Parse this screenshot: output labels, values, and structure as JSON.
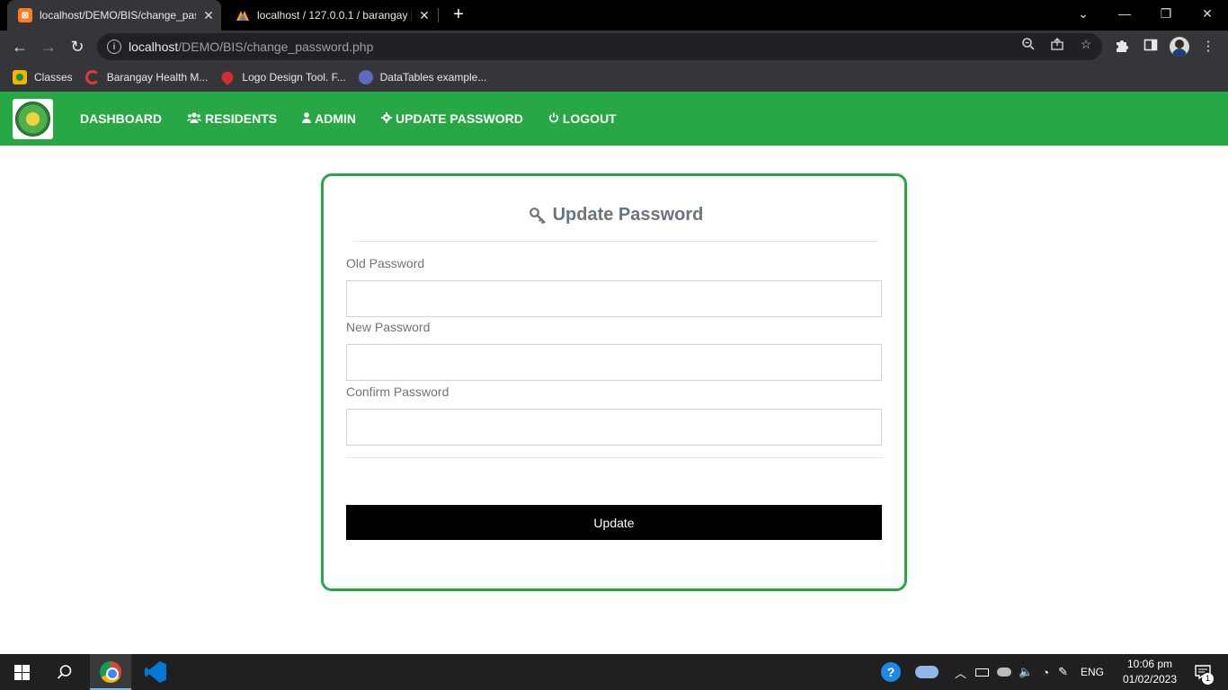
{
  "browser": {
    "tabs": [
      {
        "title": "localhost/DEMO/BIS/change_pas",
        "favicon": "xampp-icon",
        "active": true
      },
      {
        "title": "localhost / 127.0.0.1 / barangay |",
        "favicon": "phpmyadmin-icon",
        "active": false
      }
    ],
    "url_host": "localhost",
    "url_path": "/DEMO/BIS/change_password.php",
    "info_glyph": "i",
    "bookmarks": [
      {
        "label": "Classes",
        "icon": "google-classroom-icon"
      },
      {
        "label": "Barangay Health M...",
        "icon": "c-logo-icon"
      },
      {
        "label": "Logo Design Tool. F...",
        "icon": "flame-icon"
      },
      {
        "label": "DataTables example...",
        "icon": "datatables-icon"
      }
    ]
  },
  "site": {
    "nav": [
      {
        "label": "DASHBOARD",
        "icon": ""
      },
      {
        "label": "RESIDENTS",
        "icon": "users-icon"
      },
      {
        "label": "ADMIN",
        "icon": "user-icon"
      },
      {
        "label": "UPDATE PASSWORD",
        "icon": "cog-icon"
      },
      {
        "label": "LOGOUT",
        "icon": "power-icon"
      }
    ]
  },
  "form": {
    "title": "Update Password",
    "fields": [
      {
        "label": "Old Password",
        "value": ""
      },
      {
        "label": "New Password",
        "value": ""
      },
      {
        "label": "Confirm Password",
        "value": ""
      }
    ],
    "submit_label": "Update"
  },
  "taskbar": {
    "lang": "ENG",
    "time": "10:06 pm",
    "date": "01/02/2023",
    "notification_count": "1"
  },
  "colors": {
    "brand_green": "#28a745",
    "button_black": "#000000",
    "muted_text": "#6c757d"
  }
}
